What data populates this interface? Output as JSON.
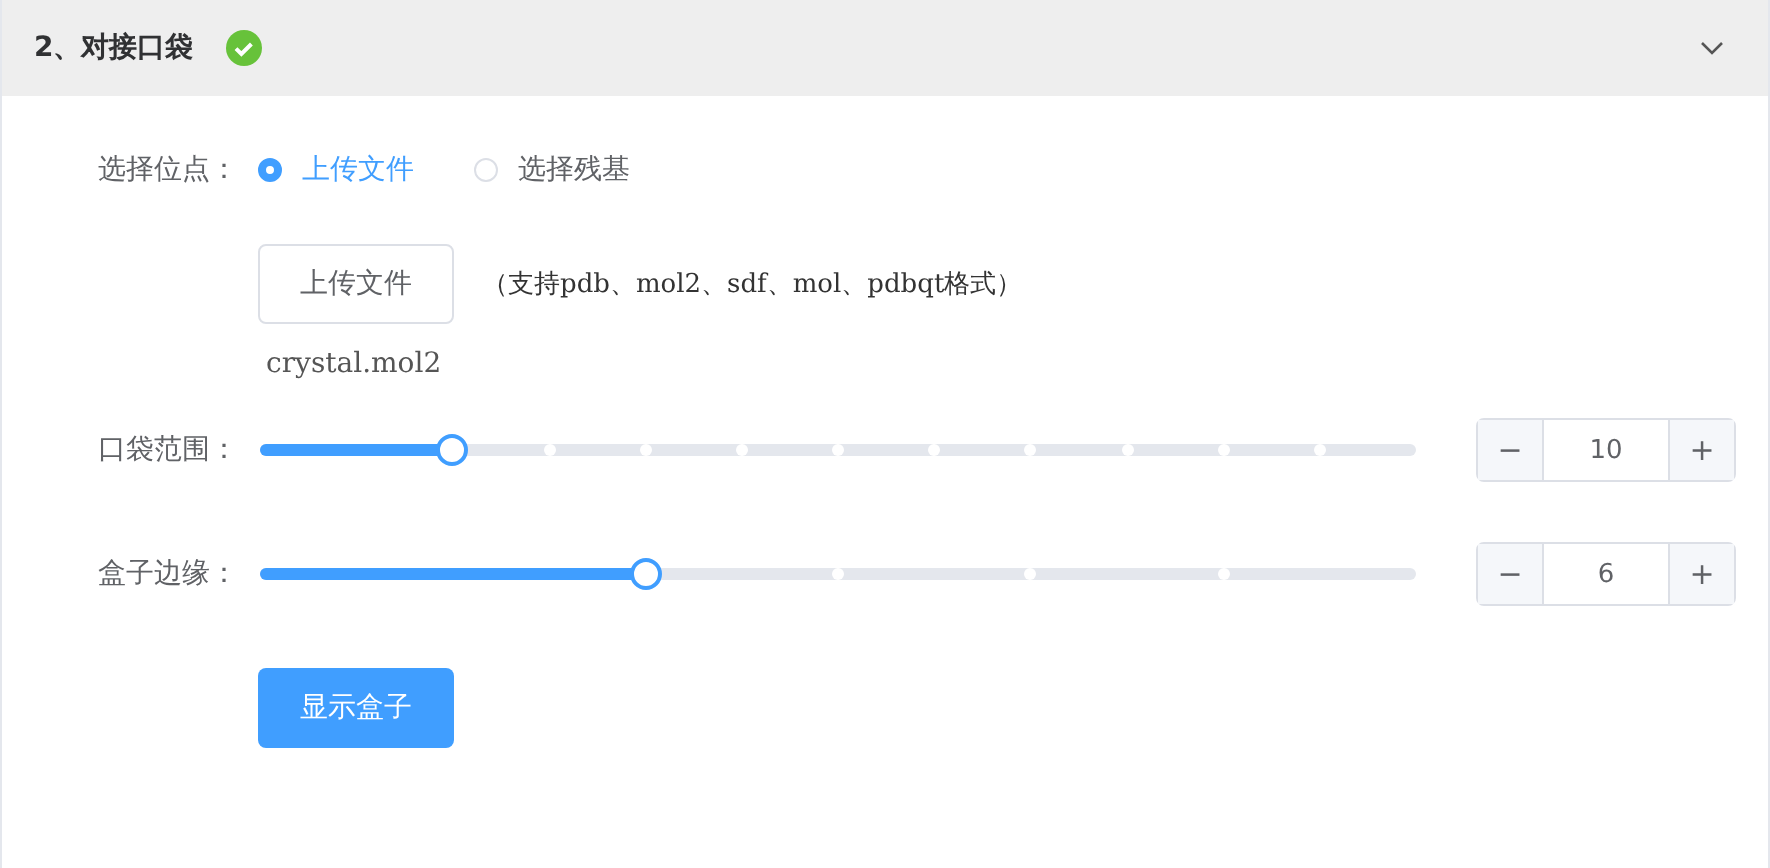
{
  "section": {
    "title": "2、对接口袋",
    "done": true,
    "expanded": true
  },
  "site": {
    "label": "选择位点：",
    "options": [
      {
        "label": "上传文件",
        "selected": true
      },
      {
        "label": "选择残基",
        "selected": false
      }
    ]
  },
  "upload": {
    "button": "上传文件",
    "hint": "（支持pdb、mol2、sdf、mol、pdbqt格式）",
    "file": "crystal.mol2"
  },
  "sliders": [
    {
      "label": "口袋范围：",
      "level": 0.1667,
      "value": "10",
      "minus": "−",
      "plus": "+"
    },
    {
      "label": "盒子边缘：",
      "level": 0.3333,
      "value": "6",
      "minus": "−",
      "plus": "+"
    }
  ],
  "show_button": "显示盒子"
}
